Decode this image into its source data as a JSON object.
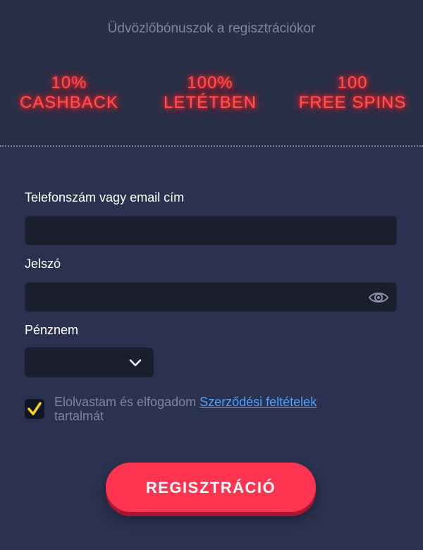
{
  "header": {
    "welcome_text": "Üdvözlőbónuszok a regisztrációkor"
  },
  "bonuses": [
    {
      "line1": "10%",
      "line2": "CASHBACK"
    },
    {
      "line1": "100%",
      "line2": "LETÉTBEN"
    },
    {
      "line1": "100",
      "line2": "FREE SPINS"
    }
  ],
  "form": {
    "login_label": "Telefonszám vagy email cím",
    "login_value": "",
    "login_placeholder": "",
    "password_label": "Jelszó",
    "password_value": "",
    "password_placeholder": "",
    "password_toggle_icon": "eye-icon",
    "currency_label": "Pénznem",
    "currency_value": "",
    "currency_icon": "chevron-down-icon",
    "terms_checked": true,
    "terms_text_before": "Elolvastam és elfogadom ",
    "terms_link": "Szerződési feltételek",
    "terms_text_after": "tartalmát",
    "submit_label": "REGISZTRÁCIÓ"
  },
  "colors": {
    "background": "#2b3250",
    "neon": "#ff5252",
    "accent_button": "#ff3451",
    "checkbox_check": "#ffd21a",
    "link": "#4aa3ff"
  }
}
